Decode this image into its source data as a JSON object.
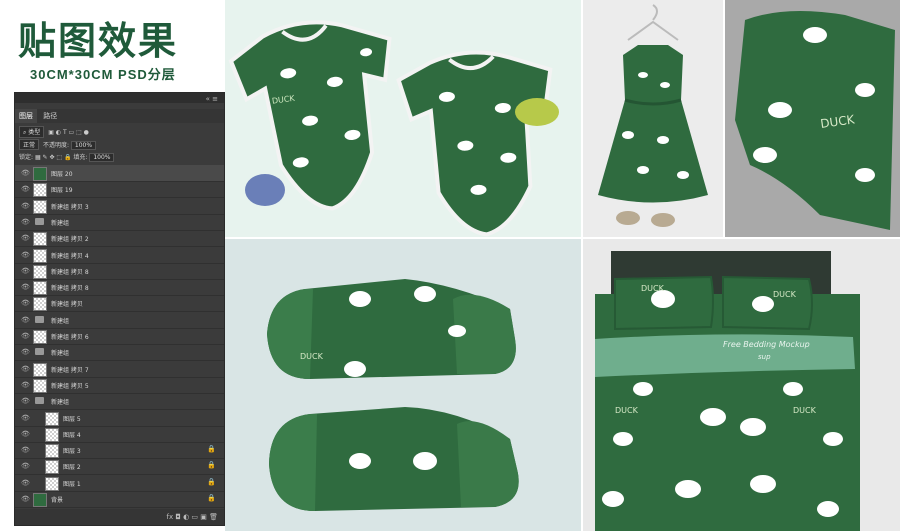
{
  "header": {
    "title": "贴图效果",
    "subtitle": "30CM*30CM   PSD分层"
  },
  "ps_panel": {
    "tabs": [
      "图层",
      "路径"
    ],
    "kind_label": "类型",
    "blend_mode": "正常",
    "opacity_label": "不透明度:",
    "opacity_value": "100%",
    "lock_label": "锁定:",
    "fill_label": "填充:",
    "fill_value": "100%",
    "layers": [
      {
        "name": "图层 20",
        "type": "layer",
        "selected": true,
        "thumb": "green"
      },
      {
        "name": "图层 19",
        "type": "layer"
      },
      {
        "name": "新建组 拷贝 3",
        "type": "layer"
      },
      {
        "name": "新建组",
        "type": "group"
      },
      {
        "name": "新建组 拷贝 2",
        "type": "layer"
      },
      {
        "name": "新建组 拷贝 4",
        "type": "layer"
      },
      {
        "name": "新建组 拷贝 8",
        "type": "layer"
      },
      {
        "name": "新建组 拷贝 8",
        "type": "layer"
      },
      {
        "name": "新建组 拷贝",
        "type": "layer"
      },
      {
        "name": "新建组",
        "type": "group"
      },
      {
        "name": "新建组 拷贝 6",
        "type": "layer"
      },
      {
        "name": "新建组",
        "type": "group"
      },
      {
        "name": "新建组 拷贝 7",
        "type": "layer"
      },
      {
        "name": "新建组 拷贝 5",
        "type": "layer"
      },
      {
        "name": "新建组",
        "type": "group"
      },
      {
        "name": "图层 5",
        "type": "layer",
        "indent": true
      },
      {
        "name": "图层 4",
        "type": "layer",
        "indent": true
      },
      {
        "name": "图层 3",
        "type": "layer",
        "indent": true,
        "locked": true
      },
      {
        "name": "图层 2",
        "type": "layer",
        "indent": true,
        "locked": true
      },
      {
        "name": "图层 1",
        "type": "layer",
        "indent": true,
        "locked": true
      },
      {
        "name": "背景",
        "type": "layer",
        "thumb": "green",
        "locked": true
      }
    ],
    "bottom_icons": "fx ◘ ◐ ▭ ▣ 🗑"
  },
  "mockups": {
    "pattern_text": "DUCK",
    "bedding_label": "Free Bedding Mockup",
    "bedding_sublabel": "sup"
  },
  "colors": {
    "pattern_green": "#2f6b3f",
    "title_green": "#1f5a3a",
    "sheet_mint": "#6fae8d"
  }
}
